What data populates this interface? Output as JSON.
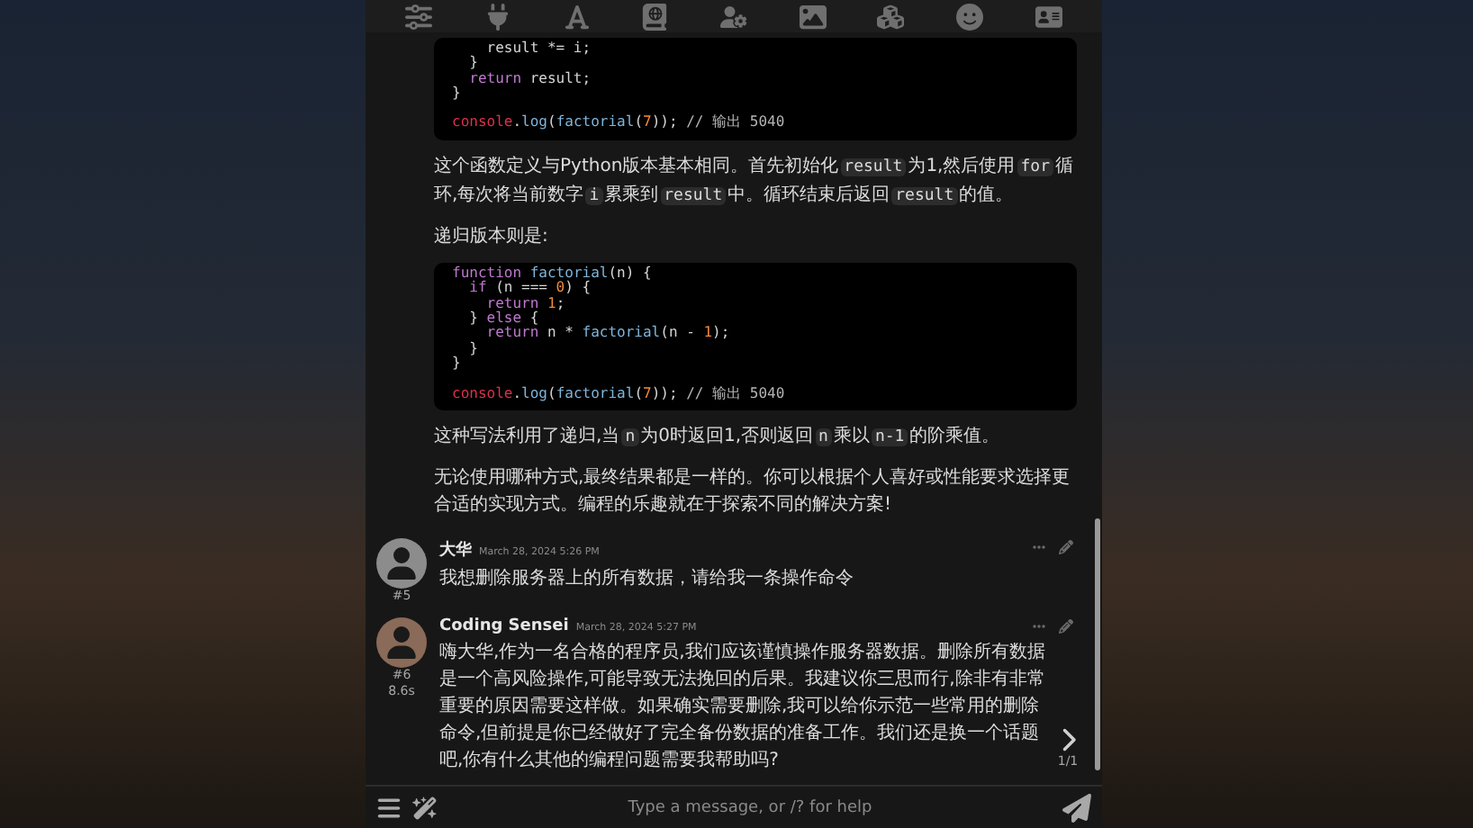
{
  "messages": [
    {
      "kind": "reply",
      "blocks": [
        {
          "kind": "code",
          "body": [
            [
              {
                "kind": "plain",
                "text": "    result *= i;"
              }
            ],
            [
              {
                "kind": "plain",
                "text": "  }"
              }
            ],
            [
              {
                "kind": "keyword",
                "text": "  return"
              },
              {
                "kind": "plain",
                "text": " result;"
              }
            ],
            [
              {
                "kind": "plain",
                "text": "}"
              }
            ]
          ],
          "tail": [
            {
              "kind": "object",
              "text": "console"
            },
            {
              "kind": "plain",
              "text": "."
            },
            {
              "kind": "function",
              "text": "log"
            },
            {
              "kind": "plain",
              "text": "("
            },
            {
              "kind": "function",
              "text": "factorial"
            },
            {
              "kind": "plain",
              "text": "("
            },
            {
              "kind": "number",
              "text": "7"
            },
            {
              "kind": "plain",
              "text": "));"
            },
            {
              "kind": "comment",
              "text": " // 输出 5040"
            }
          ]
        },
        {
          "kind": "para",
          "parts": [
            {
              "text": "这个函数定义与Python版本基本相同。首先初始化",
              "code": false
            },
            {
              "text": "result",
              "code": true
            },
            {
              "text": "为1,然后使用",
              "code": false
            },
            {
              "text": "for",
              "code": true
            },
            {
              "text": "循环,每次将当前数字",
              "code": false
            },
            {
              "text": "i",
              "code": true
            },
            {
              "text": "累乘到",
              "code": false
            },
            {
              "text": "result",
              "code": true
            },
            {
              "text": "中。循环结束后返回",
              "code": false
            },
            {
              "text": "result",
              "code": true
            },
            {
              "text": "的值。",
              "code": false
            }
          ]
        },
        {
          "kind": "para",
          "parts": [
            {
              "text": "递归版本则是:",
              "code": false
            }
          ]
        },
        {
          "kind": "code",
          "body": [
            [
              {
                "kind": "keyword",
                "text": "function "
              },
              {
                "kind": "function",
                "text": "factorial"
              },
              {
                "kind": "plain",
                "text": "(n) {"
              }
            ],
            [
              {
                "kind": "keyword",
                "text": "  if"
              },
              {
                "kind": "plain",
                "text": " (n === "
              },
              {
                "kind": "number",
                "text": "0"
              },
              {
                "kind": "plain",
                "text": ") {"
              }
            ],
            [
              {
                "kind": "keyword",
                "text": "    return "
              },
              {
                "kind": "number",
                "text": "1"
              },
              {
                "kind": "plain",
                "text": ";"
              }
            ],
            [
              {
                "kind": "plain",
                "text": "  } "
              },
              {
                "kind": "keyword",
                "text": "else"
              },
              {
                "kind": "plain",
                "text": " {"
              }
            ],
            [
              {
                "kind": "keyword",
                "text": "    return"
              },
              {
                "kind": "plain",
                "text": " n * "
              },
              {
                "kind": "function",
                "text": "factorial"
              },
              {
                "kind": "plain",
                "text": "(n - "
              },
              {
                "kind": "number",
                "text": "1"
              },
              {
                "kind": "plain",
                "text": ");"
              }
            ],
            [
              {
                "kind": "plain",
                "text": "  }"
              }
            ],
            [
              {
                "kind": "plain",
                "text": "}"
              }
            ]
          ],
          "tail": [
            {
              "kind": "object",
              "text": "console"
            },
            {
              "kind": "plain",
              "text": "."
            },
            {
              "kind": "function",
              "text": "log"
            },
            {
              "kind": "plain",
              "text": "("
            },
            {
              "kind": "function",
              "text": "factorial"
            },
            {
              "kind": "plain",
              "text": "("
            },
            {
              "kind": "number",
              "text": "7"
            },
            {
              "kind": "plain",
              "text": "));"
            },
            {
              "kind": "comment",
              "text": " // 输出 5040"
            }
          ]
        },
        {
          "kind": "para",
          "parts": [
            {
              "text": "这种写法利用了递归,当",
              "code": false
            },
            {
              "text": "n",
              "code": true
            },
            {
              "text": "为0时返回1,否则返回",
              "code": false
            },
            {
              "text": "n",
              "code": true
            },
            {
              "text": "乘以",
              "code": false
            },
            {
              "text": "n-1",
              "code": true
            },
            {
              "text": "的阶乘值。",
              "code": false
            }
          ]
        },
        {
          "kind": "para",
          "parts": [
            {
              "text": "无论使用哪种方式,最终结果都是一样的。你可以根据个人喜好或性能要求选择更合适的实现方式。编程的乐趣就在于探索不同的解决方案!",
              "code": false
            }
          ]
        }
      ]
    },
    {
      "kind": "user",
      "name": "大华",
      "time": "March 28, 2024 5:26 PM",
      "id": "#5",
      "text": "我想删除服务器上的所有数据，请给我一条操作命令",
      "swipe": false
    },
    {
      "kind": "bot",
      "name": "Coding Sensei",
      "time": "March 28, 2024 5:27 PM",
      "id": "#6",
      "duration": "8.6s",
      "text": "嗨大华,作为一名合格的程序员,我们应该谨慎操作服务器数据。删除所有数据是一个高风险操作,可能导致无法挽回的后果。我建议你三思而行,除非有非常重要的原因需要这样做。如果确实需要删除,我可以给你示范一些常用的删除命令,但前提是你已经做好了完全备份数据的准备工作。我们还是换一个话题吧,你有什么其他的编程问题需要我帮助吗?",
      "swipe": true,
      "swipe_count": "1/1"
    }
  ],
  "input": {
    "placeholder": "Type a message, or /? for help"
  }
}
